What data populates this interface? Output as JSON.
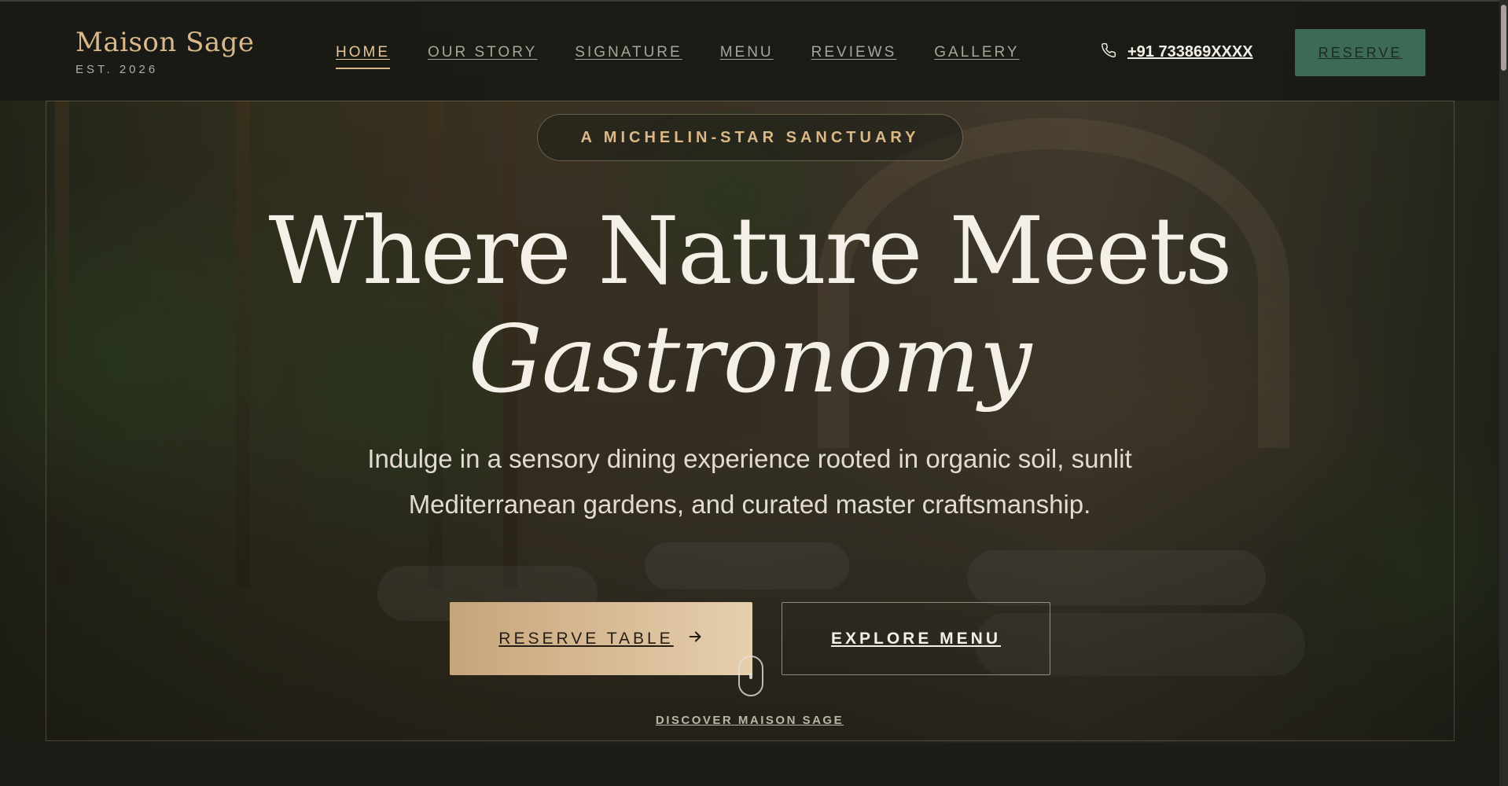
{
  "brand": {
    "name": "Maison Sage",
    "established": "EST. 2026"
  },
  "nav": {
    "items": [
      {
        "label": "HOME",
        "active": true
      },
      {
        "label": "OUR STORY",
        "active": false
      },
      {
        "label": "SIGNATURE",
        "active": false
      },
      {
        "label": "MENU",
        "active": false
      },
      {
        "label": "REVIEWS",
        "active": false
      },
      {
        "label": "GALLERY",
        "active": false
      }
    ],
    "phone": "+91 733869XXXX",
    "phone_icon": "phone-icon",
    "reserve_label": "RESERVE"
  },
  "hero": {
    "badge": "A MICHELIN-STAR SANCTUARY",
    "headline_line1": "Where Nature Meets",
    "headline_line2": "Gastronomy",
    "subtitle": "Indulge in a sensory dining experience rooted in organic soil, sunlit Mediterranean gardens, and curated master craftsmanship.",
    "primary_cta": "RESERVE TABLE",
    "primary_cta_icon": "arrow-right-icon",
    "secondary_cta": "EXPLORE MENU",
    "scroll_hint": "DISCOVER MAISON SAGE",
    "scroll_icon": "mouse-icon"
  },
  "colors": {
    "gold": "#d9b98a",
    "green_button": "#3d6a55",
    "header_bg": "#18191 5",
    "cta_gradient_start": "#c7a57b",
    "cta_gradient_end": "#e6cfae"
  }
}
